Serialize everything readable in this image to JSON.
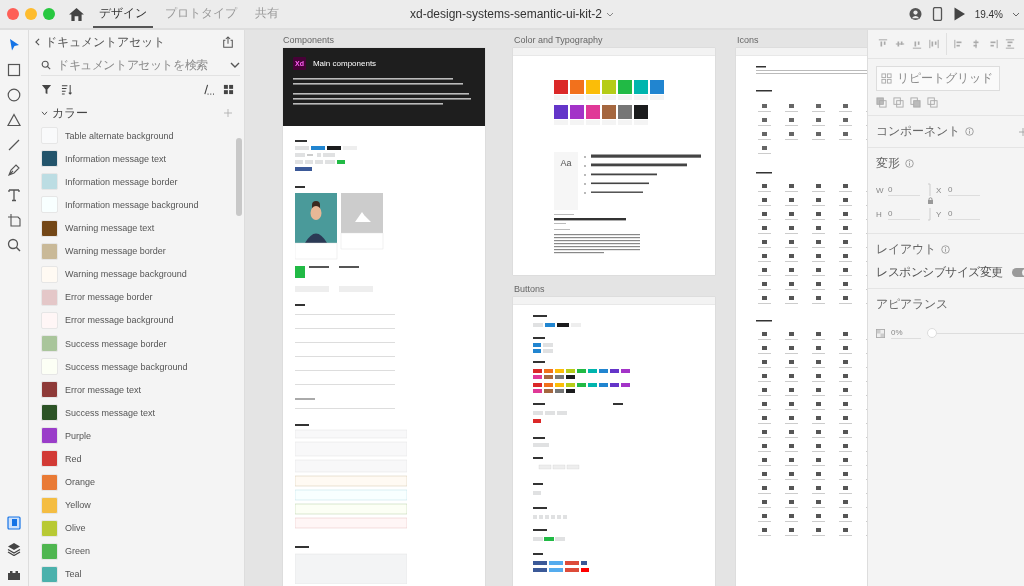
{
  "window": {
    "title": "xd-design-systems-semantic-ui-kit-2",
    "zoom": "19.4%"
  },
  "mode_tabs": [
    {
      "label": "デザイン",
      "selected": true
    },
    {
      "label": "プロトタイプ",
      "selected": false
    },
    {
      "label": "共有",
      "selected": false
    }
  ],
  "tools": [
    {
      "kind": "select",
      "selected": true
    },
    {
      "kind": "rectangle",
      "selected": false
    },
    {
      "kind": "ellipse",
      "selected": false
    },
    {
      "kind": "triangle",
      "selected": false
    },
    {
      "kind": "line",
      "selected": false
    },
    {
      "kind": "pen",
      "selected": false
    },
    {
      "kind": "text",
      "selected": false
    },
    {
      "kind": "artboard",
      "selected": false
    },
    {
      "kind": "zoom",
      "selected": false
    }
  ],
  "panel_switcher": [
    {
      "kind": "assets",
      "selected": true
    },
    {
      "kind": "layers",
      "selected": false
    },
    {
      "kind": "plugins",
      "selected": false
    }
  ],
  "assets_panel": {
    "title": "ドキュメントアセット",
    "search": {
      "placeholder": "ドキュメントアセットを検索"
    },
    "section": {
      "label": "カラー",
      "expanded": true
    },
    "colors": [
      {
        "name": "Table alternate background",
        "color": "#f9fafb"
      },
      {
        "name": "Information message text",
        "color": "#23546b"
      },
      {
        "name": "Information message border",
        "color": "#bcdde3"
      },
      {
        "name": "Information message background",
        "color": "#f8ffff"
      },
      {
        "name": "Warning message text",
        "color": "#734717"
      },
      {
        "name": "Warning message border",
        "color": "#c9b998"
      },
      {
        "name": "Warning message background",
        "color": "#fffaf3"
      },
      {
        "name": "Error message border",
        "color": "#e4c7c8"
      },
      {
        "name": "Error message background",
        "color": "#fff6f6"
      },
      {
        "name": "Success message border",
        "color": "#a9c59b"
      },
      {
        "name": "Success message background",
        "color": "#fcfff5"
      },
      {
        "name": "Error message text",
        "color": "#8e3a38"
      },
      {
        "name": "Success message text",
        "color": "#2c5326"
      },
      {
        "name": "Purple",
        "color": "#9a3dc9"
      },
      {
        "name": "Red",
        "color": "#d23a35"
      },
      {
        "name": "Orange",
        "color": "#e97a35"
      },
      {
        "name": "Yellow",
        "color": "#f4bd42"
      },
      {
        "name": "Olive",
        "color": "#b8c934"
      },
      {
        "name": "Green",
        "color": "#4fb650"
      },
      {
        "name": "Teal",
        "color": "#4bb1ac"
      }
    ]
  },
  "canvas": {
    "artboards": [
      {
        "kind": "components",
        "title": "Components",
        "logo": "Xd",
        "heading": "Main components"
      },
      {
        "kind": "typography",
        "title": "Color and Typography",
        "sample": "Aa"
      },
      {
        "kind": "buttons",
        "title": "Buttons"
      },
      {
        "kind": "icons",
        "title": "Icons"
      }
    ]
  },
  "inspector": {
    "repeat_grid": "リピートグリッド",
    "component": {
      "label": "コンポーネント"
    },
    "transform": {
      "label": "変形",
      "fields": [
        {
          "label": "W",
          "value": "0"
        },
        {
          "label": "X",
          "value": "0"
        },
        {
          "label": "H",
          "value": "0"
        },
        {
          "label": "Y",
          "value": "0"
        }
      ]
    },
    "layout": {
      "label": "レイアウト",
      "responsive": {
        "label": "レスポンシブサイズ変更",
        "on": true
      }
    },
    "appearance": {
      "label": "アピアランス",
      "opacity": {
        "value": "0%",
        "level": 0
      }
    }
  }
}
